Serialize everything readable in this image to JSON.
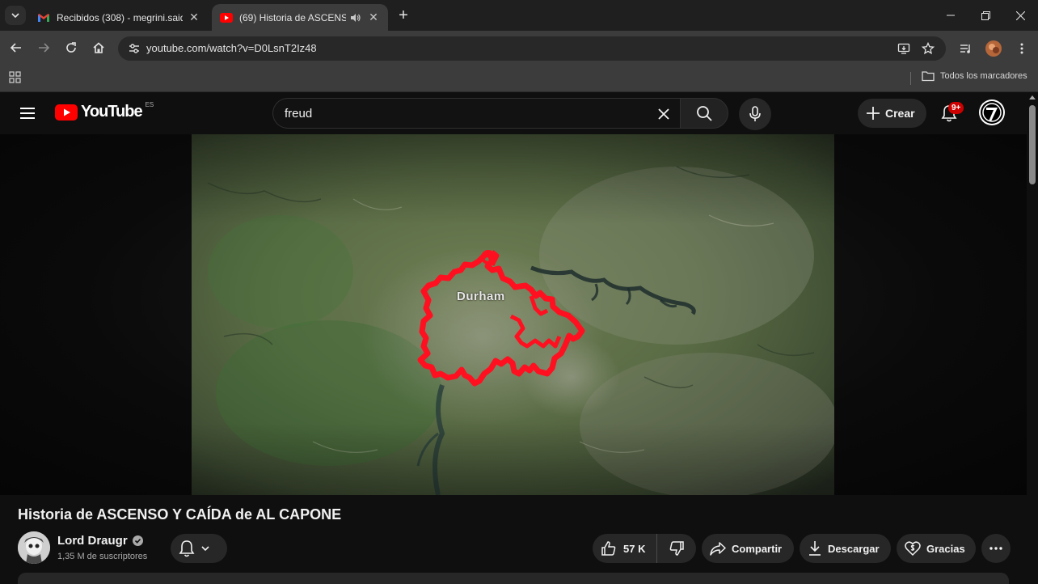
{
  "browser": {
    "tabs": [
      {
        "title": "Recibidos (308) - megrini.said@",
        "active": false,
        "favicon": "gmail-icon"
      },
      {
        "title": "(69) Historia de ASCENSO Y",
        "active": true,
        "favicon": "youtube-icon",
        "audio": true
      }
    ],
    "url": "youtube.com/watch?v=D0LsnT2Iz48",
    "bookmarks": {
      "all_label": "Todos los marcadores"
    }
  },
  "youtube": {
    "logo_text": "YouTube",
    "country_code": "ES",
    "search_value": "freud",
    "create_label": "Crear",
    "notification_badge": "9+"
  },
  "video": {
    "map_label": "Durham",
    "title": "Historia de ASCENSO Y CAÍDA de AL CAPONE",
    "channel": {
      "name": "Lord Draugr",
      "subscribers": "1,35 M de suscriptores",
      "verified": true
    },
    "actions": {
      "likes": "57 K",
      "share_label": "Compartir",
      "download_label": "Descargar",
      "thanks_label": "Gracias"
    }
  },
  "colors": {
    "brand_red": "#ff0000",
    "badge_red": "#cc0000",
    "route_red": "#ff1020",
    "background": "#0f0f0f"
  }
}
